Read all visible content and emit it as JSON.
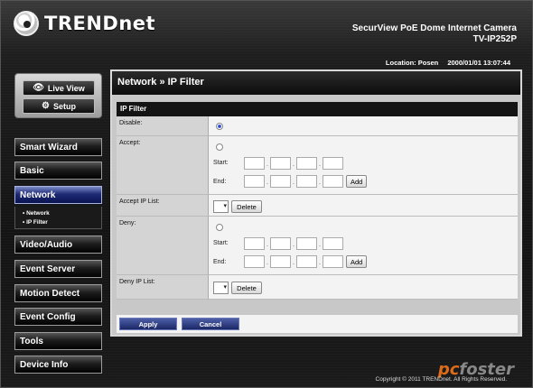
{
  "brand": {
    "logo_text": "TRENDnet"
  },
  "header": {
    "camera_title": "SecurView PoE Dome Internet Camera",
    "camera_model": "TV-IP252P",
    "location_label": "Location: Posen",
    "datetime": "2000/01/01 13:07:44"
  },
  "view_buttons": {
    "live_view": "Live View",
    "setup": "Setup"
  },
  "menu": {
    "items": [
      "Smart Wizard",
      "Basic",
      "Network",
      "Video/Audio",
      "Event Server",
      "Motion Detect",
      "Event Config",
      "Tools",
      "Device Info"
    ],
    "active": "Network",
    "submenu": [
      "• Network",
      "• IP Filter"
    ]
  },
  "page": {
    "title": "Network » IP Filter",
    "section": "IP Filter",
    "disable_label": "Disable:",
    "accept_label": "Accept:",
    "accept_list_label": "Accept IP List:",
    "deny_label": "Deny:",
    "deny_list_label": "Deny IP List:",
    "start_label": "Start:",
    "end_label": "End:",
    "add_label": "Add",
    "delete_label": "Delete",
    "selected_mode": "Disable"
  },
  "actions": {
    "apply": "Apply",
    "cancel": "Cancel"
  },
  "footer": {
    "copyright": "Copyright © 2011 TRENDnet. All Rights Reserved."
  },
  "watermark": {
    "part1": "pc",
    "part2": "foster"
  },
  "colors": {
    "active_menu": "#1e2a74",
    "action_button": "#1b2866",
    "radio_selected": "#1a3bd0"
  }
}
